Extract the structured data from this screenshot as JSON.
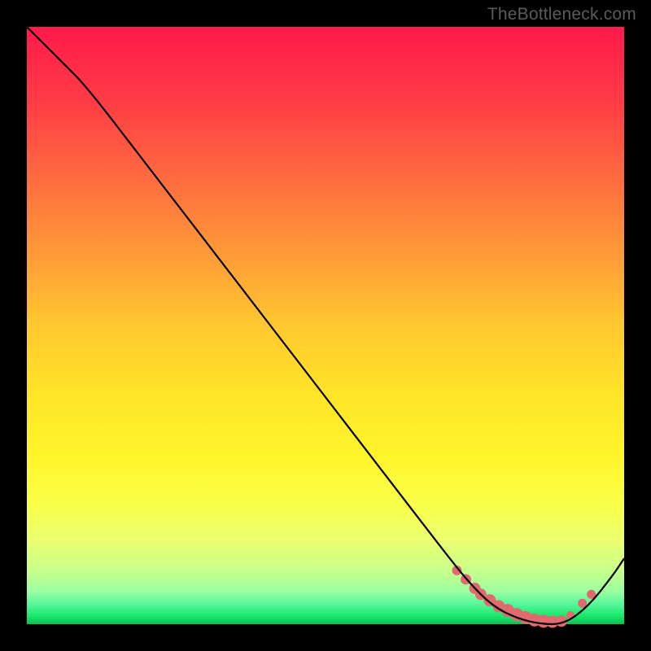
{
  "watermark": "TheBottleneck.com",
  "chart_data": {
    "type": "line",
    "title": "",
    "xlabel": "",
    "ylabel": "",
    "xlim": [
      0,
      100
    ],
    "ylim": [
      0,
      100
    ],
    "grid": false,
    "legend": false,
    "series": [
      {
        "name": "curve",
        "stroke": "#000000",
        "x": [
          0,
          6,
          10,
          20,
          30,
          40,
          50,
          60,
          70,
          74,
          78,
          82,
          86,
          90,
          94,
          98,
          100
        ],
        "y": [
          100,
          94,
          90,
          77,
          64,
          51,
          38,
          25,
          12,
          7,
          3,
          1,
          0,
          0,
          3,
          8,
          11
        ]
      }
    ],
    "markers": {
      "name": "trough-markers",
      "color": "#e16a6f",
      "x": [
        72,
        73.5,
        75,
        76,
        77.5,
        79,
        80.5,
        82,
        83.5,
        85,
        86.5,
        88,
        89.5,
        91,
        93,
        94.5
      ],
      "y": [
        9,
        7.5,
        6,
        5,
        4,
        3,
        2.3,
        1.6,
        1.1,
        0.7,
        0.5,
        0.4,
        0.5,
        1.5,
        3.5,
        5
      ],
      "radius": [
        6,
        6.5,
        7,
        7,
        7.5,
        7.5,
        8,
        8,
        8,
        8,
        8,
        7.5,
        7,
        5,
        5.5,
        5.5
      ]
    },
    "gradient_stops": [
      {
        "offset": 0.0,
        "color": "#ff1a4b"
      },
      {
        "offset": 0.12,
        "color": "#ff3a46"
      },
      {
        "offset": 0.25,
        "color": "#ff6a3f"
      },
      {
        "offset": 0.38,
        "color": "#ff9a38"
      },
      {
        "offset": 0.5,
        "color": "#ffc82f"
      },
      {
        "offset": 0.62,
        "color": "#ffe528"
      },
      {
        "offset": 0.72,
        "color": "#fff52a"
      },
      {
        "offset": 0.8,
        "color": "#faff4a"
      },
      {
        "offset": 0.86,
        "color": "#eaff70"
      },
      {
        "offset": 0.91,
        "color": "#c8ff8a"
      },
      {
        "offset": 0.945,
        "color": "#9bffa0"
      },
      {
        "offset": 0.965,
        "color": "#5cf79b"
      },
      {
        "offset": 0.985,
        "color": "#1de96f"
      },
      {
        "offset": 1.0,
        "color": "#09c24e"
      }
    ]
  }
}
